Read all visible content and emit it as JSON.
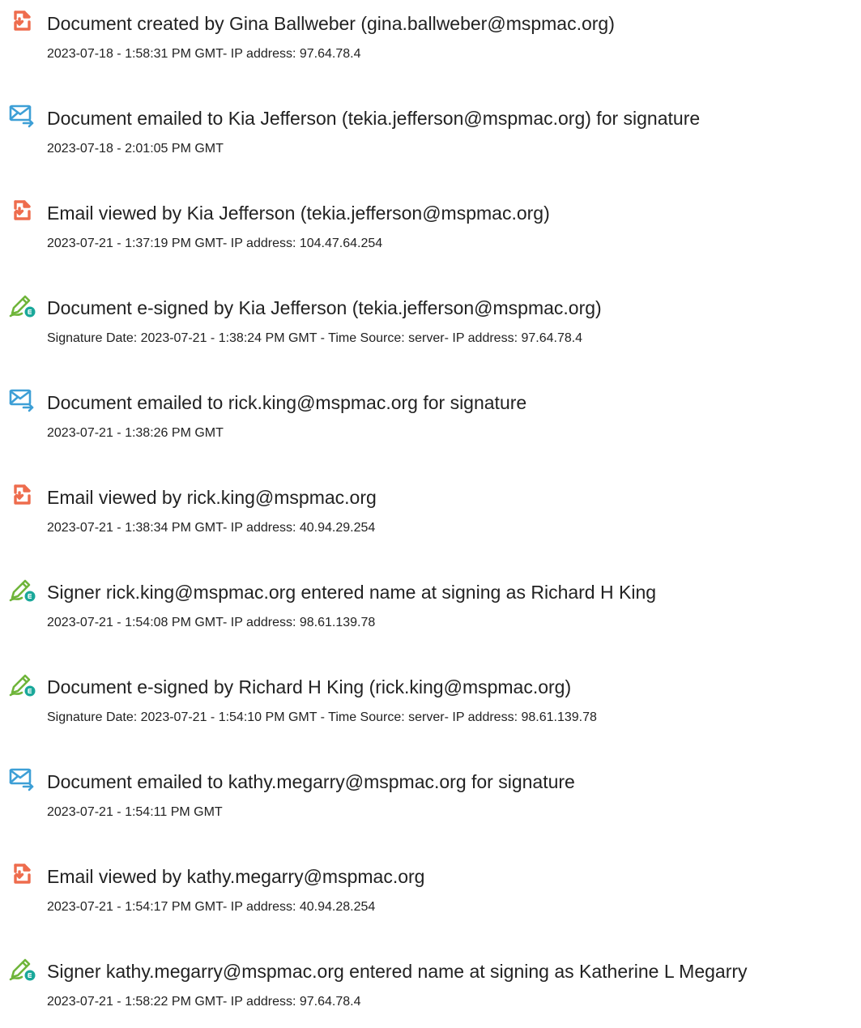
{
  "colors": {
    "created_icon": "#ee6c4d",
    "email_icon": "#3d9fd6",
    "esign_pen": "#6fb53a",
    "esign_dot": "#1aa89a"
  },
  "events": [
    {
      "icon": "document-icon",
      "title": "Document created by Gina Ballweber (gina.ballweber@mspmac.org)",
      "detail": "2023-07-18 - 1:58:31 PM GMT- IP address: 97.64.78.4"
    },
    {
      "icon": "email-sent-icon",
      "title": "Document emailed to Kia Jefferson (tekia.jefferson@mspmac.org) for signature",
      "detail": "2023-07-18 - 2:01:05 PM GMT"
    },
    {
      "icon": "document-icon",
      "title": "Email viewed by Kia Jefferson (tekia.jefferson@mspmac.org)",
      "detail": "2023-07-21 - 1:37:19 PM GMT- IP address: 104.47.64.254"
    },
    {
      "icon": "esign-pen-icon",
      "title": "Document e-signed by Kia Jefferson (tekia.jefferson@mspmac.org)",
      "detail": "Signature Date: 2023-07-21 - 1:38:24 PM GMT - Time Source: server- IP address: 97.64.78.4"
    },
    {
      "icon": "email-sent-icon",
      "title": "Document emailed to rick.king@mspmac.org for signature",
      "detail": "2023-07-21 - 1:38:26 PM GMT"
    },
    {
      "icon": "document-icon",
      "title": "Email viewed by rick.king@mspmac.org",
      "detail": "2023-07-21 - 1:38:34 PM GMT- IP address: 40.94.29.254"
    },
    {
      "icon": "esign-pen-icon",
      "title": "Signer rick.king@mspmac.org entered name at signing as Richard H King",
      "detail": "2023-07-21 - 1:54:08 PM GMT- IP address: 98.61.139.78"
    },
    {
      "icon": "esign-pen-icon",
      "title": "Document e-signed by Richard H King (rick.king@mspmac.org)",
      "detail": "Signature Date: 2023-07-21 - 1:54:10 PM GMT - Time Source: server- IP address: 98.61.139.78"
    },
    {
      "icon": "email-sent-icon",
      "title": "Document emailed to kathy.megarry@mspmac.org for signature",
      "detail": "2023-07-21 - 1:54:11 PM GMT"
    },
    {
      "icon": "document-icon",
      "title": "Email viewed by kathy.megarry@mspmac.org",
      "detail": "2023-07-21 - 1:54:17 PM GMT- IP address: 40.94.28.254"
    },
    {
      "icon": "esign-pen-icon",
      "title": "Signer kathy.megarry@mspmac.org entered name at signing as Katherine L Megarry",
      "detail": "2023-07-21 - 1:58:22 PM GMT- IP address: 97.64.78.4"
    }
  ]
}
